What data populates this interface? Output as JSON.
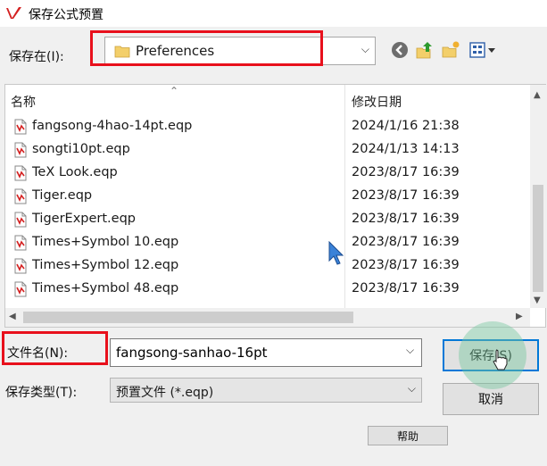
{
  "window": {
    "title": "保存公式预置"
  },
  "save_in": {
    "label": "保存在(I):",
    "folder": "Preferences"
  },
  "toolbar": {
    "icons": [
      "back-icon",
      "up-folder-icon",
      "new-folder-icon",
      "view-menu-icon"
    ]
  },
  "list": {
    "columns": {
      "name": "名称",
      "modified": "修改日期"
    },
    "rows": [
      {
        "name": "fangsong-4hao-14pt.eqp",
        "modified": "2024/1/16 21:38"
      },
      {
        "name": "songti10pt.eqp",
        "modified": "2024/1/13 14:13"
      },
      {
        "name": "TeX Look.eqp",
        "modified": "2023/8/17 16:39"
      },
      {
        "name": "Tiger.eqp",
        "modified": "2023/8/17 16:39"
      },
      {
        "name": "TigerExpert.eqp",
        "modified": "2023/8/17 16:39"
      },
      {
        "name": "Times+Symbol 10.eqp",
        "modified": "2023/8/17 16:39"
      },
      {
        "name": "Times+Symbol 12.eqp",
        "modified": "2023/8/17 16:39"
      },
      {
        "name": "Times+Symbol 48.eqp",
        "modified": "2023/8/17 16:39"
      }
    ]
  },
  "filename": {
    "label": "文件名(N):",
    "value": "fangsong-sanhao-16pt"
  },
  "filetype": {
    "label": "保存类型(T):",
    "value": "预置文件 (*.eqp)"
  },
  "buttons": {
    "save": "保存(S)",
    "cancel": "取消",
    "help": "帮助"
  },
  "colors": {
    "highlight": "#e8101c",
    "accent": "#0078d7"
  }
}
